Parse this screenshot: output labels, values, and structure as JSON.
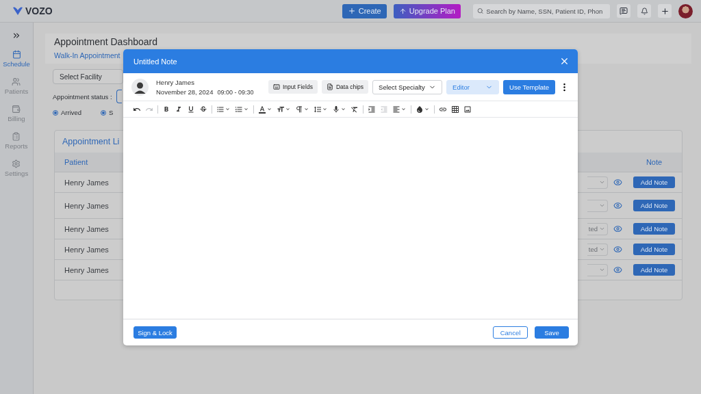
{
  "header": {
    "logo": "VOZO",
    "create": "Create",
    "upgrade": "Upgrade Plan",
    "search_placeholder": "Search by Name, SSN, Patient ID, Phon"
  },
  "sidebar": {
    "items": [
      {
        "label": "Schedule",
        "kind": "calendar",
        "selected": true
      },
      {
        "label": "Patients",
        "kind": "people",
        "selected": false
      },
      {
        "label": "Billing",
        "kind": "wallet",
        "selected": false
      },
      {
        "label": "Reports",
        "kind": "clipboard",
        "selected": false
      },
      {
        "label": "Settings",
        "kind": "gear",
        "selected": false
      }
    ]
  },
  "dashboard": {
    "title": "Appointment Dashboard",
    "tab": "Walk-In Appointment",
    "facility_select": "Select Facility",
    "status_label": "Appointment status :",
    "statuses": [
      {
        "label": "Arrived",
        "checked": true
      },
      {
        "label": "S",
        "checked": true
      }
    ]
  },
  "appointment_list": {
    "title": "Appointment Li",
    "columns": [
      "Patient",
      "Note"
    ],
    "rows": [
      {
        "patient": "Henry James",
        "note_button": "Add Note"
      },
      {
        "patient": "Henry James",
        "note_button": "Add Note"
      },
      {
        "patient": "Henry James",
        "status": "ted",
        "note_button": "Add Note"
      },
      {
        "patient": "Henry James",
        "status": "ted",
        "note_button": "Add Note"
      },
      {
        "patient": "Henry James",
        "note_button": "Add Note"
      }
    ]
  },
  "note": {
    "title": "Untitled Note",
    "patient": {
      "name": "Henry James",
      "date": "November 28, 2024",
      "time": "09:00 - 09:30"
    },
    "buttons": {
      "input_fields": "Input Fields",
      "data_chips": "Data chips",
      "specialty": "Select Specialty",
      "mode": "Editor",
      "template": "Use Template"
    },
    "toolbar": [
      [
        {
          "kind": "undo",
          "disabled": false,
          "dropdown": false
        },
        {
          "kind": "redo",
          "disabled": true,
          "dropdown": false
        }
      ],
      [
        {
          "kind": "bold",
          "disabled": false,
          "dropdown": false
        },
        {
          "kind": "italic",
          "disabled": false,
          "dropdown": false
        },
        {
          "kind": "underline",
          "disabled": false,
          "dropdown": false
        },
        {
          "kind": "strike",
          "disabled": false,
          "dropdown": false
        }
      ],
      [
        {
          "kind": "bullets",
          "disabled": false,
          "dropdown": true
        },
        {
          "kind": "numbers",
          "disabled": false,
          "dropdown": true
        }
      ],
      [
        {
          "kind": "fontcolor",
          "disabled": false,
          "dropdown": true
        },
        {
          "kind": "fontsize",
          "disabled": false,
          "dropdown": true
        },
        {
          "kind": "paragraph",
          "disabled": false,
          "dropdown": true
        },
        {
          "kind": "lineheight",
          "disabled": false,
          "dropdown": true
        },
        {
          "kind": "mic",
          "disabled": false,
          "dropdown": true
        },
        {
          "kind": "clear",
          "disabled": false,
          "dropdown": false
        }
      ],
      [
        {
          "kind": "indent",
          "disabled": false,
          "dropdown": false
        },
        {
          "kind": "outdent",
          "disabled": true,
          "dropdown": false
        },
        {
          "kind": "align",
          "disabled": false,
          "dropdown": true
        }
      ],
      [
        {
          "kind": "fill",
          "disabled": false,
          "dropdown": true
        }
      ],
      [
        {
          "kind": "link",
          "disabled": false,
          "dropdown": false
        },
        {
          "kind": "table",
          "disabled": false,
          "dropdown": false
        },
        {
          "kind": "image",
          "disabled": false,
          "dropdown": false
        }
      ]
    ],
    "footer": {
      "sign": "Sign & Lock",
      "cancel": "Cancel",
      "save": "Save"
    }
  }
}
